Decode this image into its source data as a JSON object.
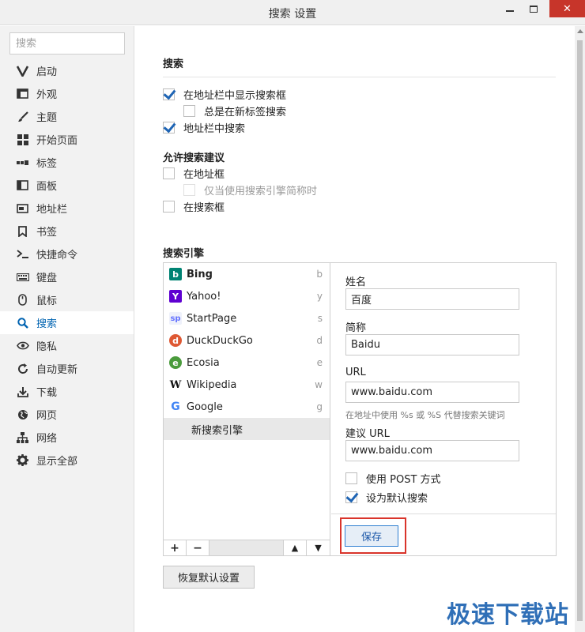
{
  "window": {
    "title": "搜索 设置",
    "minimize_glyph": "",
    "maximize_glyph": "",
    "close_glyph": "✕"
  },
  "sidebar": {
    "search_placeholder": "搜索",
    "items": [
      {
        "label": "启动",
        "icon": "vivaldi-v-icon"
      },
      {
        "label": "外观",
        "icon": "window-icon"
      },
      {
        "label": "主题",
        "icon": "brush-icon"
      },
      {
        "label": "开始页面",
        "icon": "grid-icon"
      },
      {
        "label": "标签",
        "icon": "tabs-icon"
      },
      {
        "label": "面板",
        "icon": "panel-icon"
      },
      {
        "label": "地址栏",
        "icon": "address-bar-icon"
      },
      {
        "label": "书签",
        "icon": "bookmark-icon"
      },
      {
        "label": "快捷命令",
        "icon": "command-icon"
      },
      {
        "label": "键盘",
        "icon": "keyboard-icon"
      },
      {
        "label": "鼠标",
        "icon": "mouse-icon"
      },
      {
        "label": "搜索",
        "icon": "search-icon",
        "active": true
      },
      {
        "label": "隐私",
        "icon": "eye-icon"
      },
      {
        "label": "自动更新",
        "icon": "refresh-icon"
      },
      {
        "label": "下载",
        "icon": "download-icon"
      },
      {
        "label": "网页",
        "icon": "globe-icon"
      },
      {
        "label": "网络",
        "icon": "network-icon"
      },
      {
        "label": "显示全部",
        "icon": "gear-icon"
      }
    ]
  },
  "search_section": {
    "title": "搜索",
    "show_search_field": {
      "label": "在地址栏中显示搜索框",
      "checked": true
    },
    "always_new_tab": {
      "label": "总是在新标签搜索",
      "checked": false
    },
    "search_in_address": {
      "label": "地址栏中搜索",
      "checked": true
    }
  },
  "suggest_section": {
    "title": "允许搜索建议",
    "in_address": {
      "label": "在地址框",
      "checked": false
    },
    "only_nickname": {
      "label": "仅当使用搜索引擎简称时",
      "checked": false,
      "disabled": true
    },
    "in_search_field": {
      "label": "在搜索框",
      "checked": false
    }
  },
  "engines_section": {
    "title": "搜索引擎",
    "engines": [
      {
        "name": "Bing",
        "key": "b",
        "bold": true
      },
      {
        "name": "Yahoo!",
        "key": "y"
      },
      {
        "name": "StartPage",
        "key": "s"
      },
      {
        "name": "DuckDuckGo",
        "key": "d"
      },
      {
        "name": "Ecosia",
        "key": "e"
      },
      {
        "name": "Wikipedia",
        "key": "w"
      },
      {
        "name": "Google",
        "key": "g"
      },
      {
        "name": "新搜索引擎",
        "key": "",
        "selected": true
      }
    ],
    "tools": {
      "add": "+",
      "remove": "−",
      "up": "▲",
      "down": "▼"
    },
    "detail": {
      "name_label": "姓名",
      "name_value": "百度",
      "nickname_label": "简称",
      "nickname_value": "Baidu",
      "url_label": "URL",
      "url_value": "www.baidu.com",
      "url_hint": "在地址中使用 %s 或 %S 代替搜索关键词",
      "suggest_url_label": "建议 URL",
      "suggest_url_value": "www.baidu.com",
      "use_post": {
        "label": "使用 POST 方式",
        "checked": false
      },
      "set_default": {
        "label": "设为默认搜索",
        "checked": true
      },
      "save_label": "保存"
    }
  },
  "restore_label": "恢复默认设置",
  "watermark": "极速下载站",
  "colors": {
    "accent": "#0063b1",
    "highlight_border": "#d9342b",
    "close_button": "#c7352a"
  }
}
